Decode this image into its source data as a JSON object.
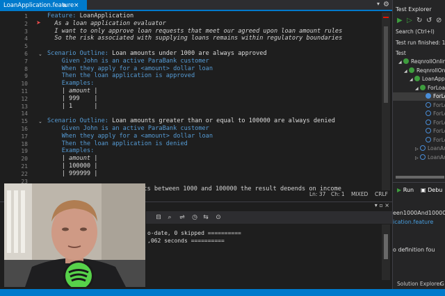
{
  "editor": {
    "tab_title": "LoanApplication.feature",
    "tab_pin": "⊕",
    "tab_close": "×",
    "lines": [
      {
        "n": "1",
        "parts": [
          {
            "c": "kw",
            "t": "Feature: "
          },
          {
            "c": "tx",
            "t": "LoanApplication"
          }
        ]
      },
      {
        "n": "2",
        "parts": [
          {
            "c": "it",
            "t": "  As a loan application evaluator"
          }
        ]
      },
      {
        "n": "3",
        "parts": [
          {
            "c": "it",
            "t": "  I want to only approve loan requests that meet our agreed upon loan amount rules"
          }
        ]
      },
      {
        "n": "4",
        "parts": [
          {
            "c": "it",
            "t": "  So the risk associated with supplying loans remains within regulatory boundaries"
          }
        ]
      },
      {
        "n": "5",
        "parts": []
      },
      {
        "n": "6",
        "parts": [
          {
            "c": "kw",
            "t": "Scenario Outline: "
          },
          {
            "c": "tx",
            "t": "Loan amounts under 1000 are always approved"
          }
        ]
      },
      {
        "n": "7",
        "parts": [
          {
            "c": "kw",
            "t": "    Given "
          },
          {
            "c": "kw",
            "t": "John is an active ParaBank customer"
          }
        ]
      },
      {
        "n": "8",
        "parts": [
          {
            "c": "kw",
            "t": "    When "
          },
          {
            "c": "kw",
            "t": "they apply for a <amount> dollar loan"
          }
        ]
      },
      {
        "n": "9",
        "parts": [
          {
            "c": "kw",
            "t": "    Then "
          },
          {
            "c": "kw",
            "t": "the loan application is approved"
          }
        ]
      },
      {
        "n": "10",
        "parts": [
          {
            "c": "kw",
            "t": "    Examples:"
          }
        ]
      },
      {
        "n": "11",
        "parts": [
          {
            "c": "tx",
            "t": "    | "
          },
          {
            "c": "it",
            "t": "amount"
          },
          {
            "c": "tx",
            "t": " |"
          }
        ]
      },
      {
        "n": "12",
        "parts": [
          {
            "c": "tx",
            "t": "    | 999    |"
          }
        ]
      },
      {
        "n": "13",
        "parts": [
          {
            "c": "tx",
            "t": "    | 1      |"
          }
        ]
      },
      {
        "n": "14",
        "parts": []
      },
      {
        "n": "15",
        "parts": [
          {
            "c": "kw",
            "t": "Scenario Outline: "
          },
          {
            "c": "tx",
            "t": "Loan amounts greater than or equal to 100000 are always denied"
          }
        ]
      },
      {
        "n": "16",
        "parts": [
          {
            "c": "kw",
            "t": "    Given "
          },
          {
            "c": "kw",
            "t": "John is an active ParaBank customer"
          }
        ]
      },
      {
        "n": "17",
        "parts": [
          {
            "c": "kw",
            "t": "    When "
          },
          {
            "c": "kw",
            "t": "they apply for a <amount> dollar loan"
          }
        ]
      },
      {
        "n": "18",
        "parts": [
          {
            "c": "kw",
            "t": "    Then "
          },
          {
            "c": "kw",
            "t": "the loan application is denied"
          }
        ]
      },
      {
        "n": "19",
        "parts": [
          {
            "c": "kw",
            "t": "    Examples:"
          }
        ]
      },
      {
        "n": "20",
        "parts": [
          {
            "c": "tx",
            "t": "    | "
          },
          {
            "c": "it",
            "t": "amount"
          },
          {
            "c": "tx",
            "t": " |"
          }
        ]
      },
      {
        "n": "21",
        "parts": [
          {
            "c": "tx",
            "t": "    | 100000 |"
          }
        ]
      },
      {
        "n": "22",
        "parts": [
          {
            "c": "tx",
            "t": "    | 999999 |"
          }
        ]
      },
      {
        "n": "23",
        "parts": []
      }
    ],
    "partial_line": "unts between 1000 and 100000 the result depends on income",
    "status": {
      "ln": "Ln: 37",
      "ch": "Ch: 1",
      "mixed": "MIXED",
      "crlf": "CRLF"
    }
  },
  "output": {
    "lines": [
      "o-date, 0 skipped ==========",
      ",062 seconds =========="
    ]
  },
  "test_explorer": {
    "title": "Test Explorer",
    "search_placeholder": "Search (Ctrl+I)",
    "run_status": "Test run finished: 1 Te",
    "column_header": "Test",
    "tree": [
      {
        "indent": 8,
        "arrow": "◢",
        "icon": "ok",
        "label": "ReqnrollOnline"
      },
      {
        "indent": 16,
        "arrow": "◢",
        "icon": "ok",
        "label": "ReqnrollOnli"
      },
      {
        "indent": 24,
        "arrow": "◢",
        "icon": "ok",
        "label": "LoanApplic"
      },
      {
        "indent": 32,
        "arrow": "◢",
        "icon": "ok",
        "label": "ForLoanA"
      },
      {
        "indent": 40,
        "arrow": "",
        "icon": "bl",
        "label": "ForLoa"
      },
      {
        "indent": 40,
        "arrow": "",
        "icon": "hol",
        "label": "ForLoa"
      },
      {
        "indent": 40,
        "arrow": "",
        "icon": "hol",
        "label": "ForLoa"
      },
      {
        "indent": 40,
        "arrow": "",
        "icon": "hol",
        "label": "ForLoa"
      },
      {
        "indent": 40,
        "arrow": "",
        "icon": "hol",
        "label": "ForLoa"
      },
      {
        "indent": 40,
        "arrow": "",
        "icon": "hol",
        "label": "ForLoa"
      },
      {
        "indent": 32,
        "arrow": "▷",
        "icon": "hol",
        "label": "LoanAmo"
      },
      {
        "indent": 32,
        "arrow": "▷",
        "icon": "hol",
        "label": "LoanAmo"
      }
    ],
    "run_label": "Run",
    "debug_label": "Debu",
    "detail_line1": "een1000And100000",
    "detail_line2": "ication.feature",
    "detail_line3": "o definition fou",
    "bottom_tabs": [
      "Solution Explorer",
      "G"
    ]
  },
  "colors": {
    "accent": "#007acc",
    "keyword": "#569cd6",
    "pass": "#3e9d3e"
  }
}
